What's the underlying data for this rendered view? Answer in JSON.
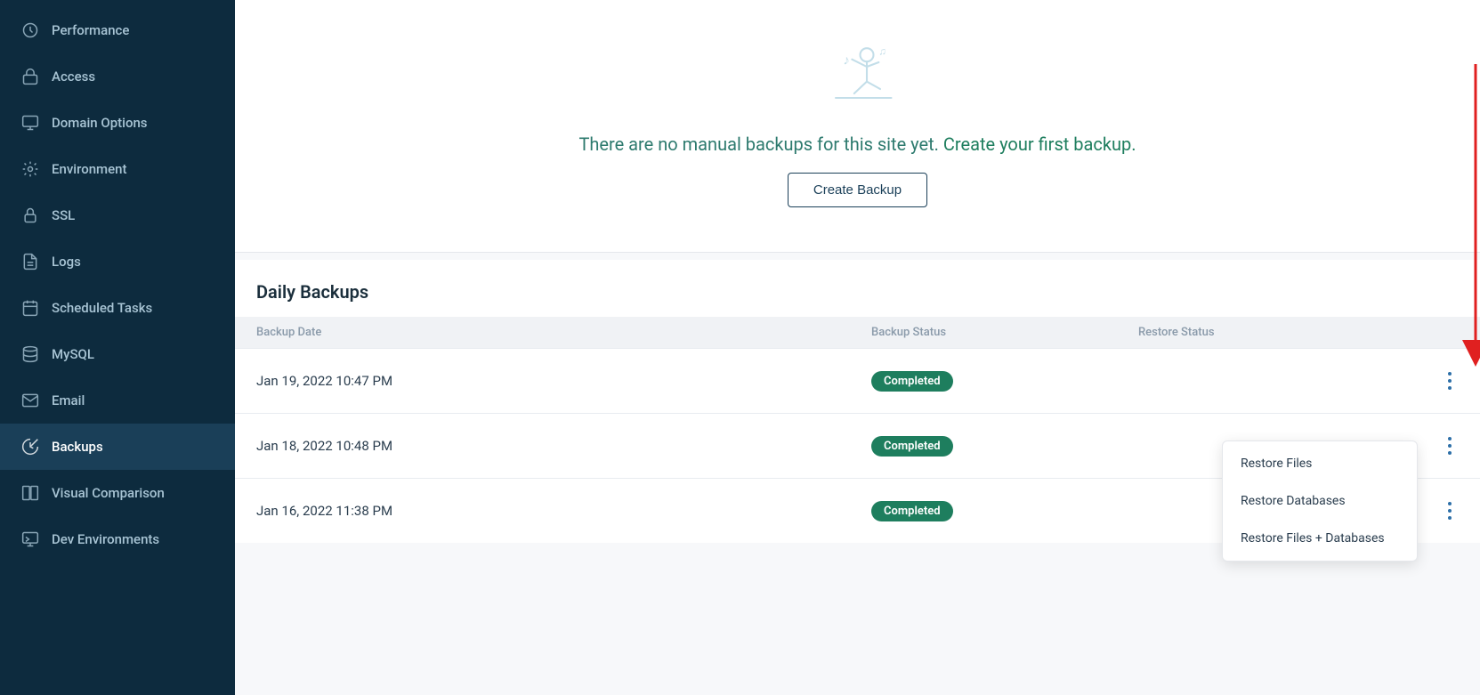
{
  "sidebar": {
    "items": [
      {
        "id": "performance",
        "label": "Performance",
        "icon": "performance-icon"
      },
      {
        "id": "access",
        "label": "Access",
        "icon": "access-icon"
      },
      {
        "id": "domain-options",
        "label": "Domain Options",
        "icon": "domain-icon"
      },
      {
        "id": "environment",
        "label": "Environment",
        "icon": "environment-icon"
      },
      {
        "id": "ssl",
        "label": "SSL",
        "icon": "ssl-icon"
      },
      {
        "id": "logs",
        "label": "Logs",
        "icon": "logs-icon"
      },
      {
        "id": "scheduled-tasks",
        "label": "Scheduled Tasks",
        "icon": "scheduled-tasks-icon"
      },
      {
        "id": "mysql",
        "label": "MySQL",
        "icon": "mysql-icon"
      },
      {
        "id": "email",
        "label": "Email",
        "icon": "email-icon"
      },
      {
        "id": "backups",
        "label": "Backups",
        "icon": "backups-icon",
        "active": true
      },
      {
        "id": "visual-comparison",
        "label": "Visual Comparison",
        "icon": "visual-comparison-icon"
      },
      {
        "id": "dev-environments",
        "label": "Dev Environments",
        "icon": "dev-environments-icon"
      }
    ]
  },
  "manual_backup": {
    "no_backup_text": "There are no manual backups for this site yet.",
    "cta_text": "Create your first backup.",
    "create_button_label": "Create Backup"
  },
  "daily_backups": {
    "section_title": "Daily Backups",
    "columns": {
      "backup_date": "Backup Date",
      "backup_status": "Backup Status",
      "restore_status": "Restore Status"
    },
    "rows": [
      {
        "date": "Jan 19, 2022 10:47 PM",
        "backup_status": "Completed",
        "restore_status": ""
      },
      {
        "date": "Jan 18, 2022 10:48 PM",
        "backup_status": "Completed",
        "restore_status": ""
      },
      {
        "date": "Jan 16, 2022 11:38 PM",
        "backup_status": "Completed",
        "restore_status": ""
      }
    ]
  },
  "dropdown": {
    "items": [
      {
        "id": "restore-files",
        "label": "Restore Files"
      },
      {
        "id": "restore-databases",
        "label": "Restore Databases"
      },
      {
        "id": "restore-files-databases",
        "label": "Restore Files + Databases"
      }
    ]
  }
}
